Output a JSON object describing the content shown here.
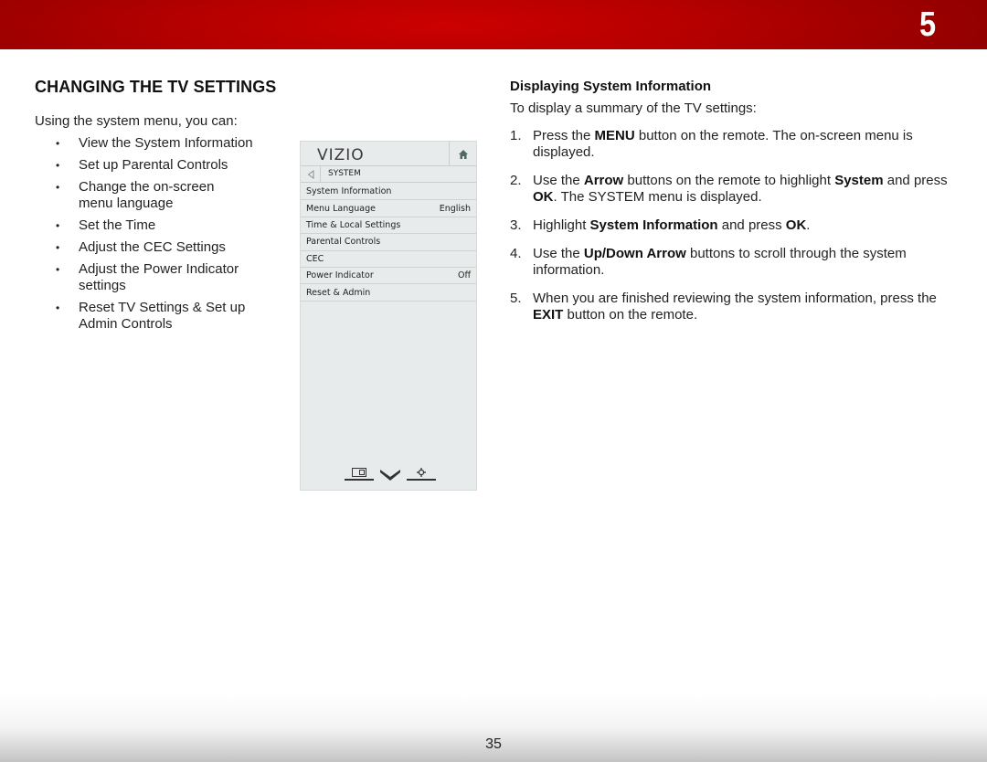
{
  "header": {
    "chapter_number": "5",
    "band_color": "#c00000"
  },
  "left": {
    "section_title": "CHANGING THE TV SETTINGS",
    "intro": "Using the system menu, you can:",
    "bullet_glyph": "•",
    "bullets": [
      "View the System Information",
      "Set up Parental Controls",
      "Change the on-screen menu language",
      "Set the Time",
      "Adjust the CEC Settings",
      "Adjust the Power Indicator settings",
      "Reset TV Settings & Set up Admin Controls"
    ]
  },
  "tv_menu": {
    "logo": "VIZIO",
    "home_icon": "home-icon",
    "back_icon": "back-arrow-icon",
    "breadcrumb": "SYSTEM",
    "items": [
      {
        "label": "System Information",
        "value": ""
      },
      {
        "label": "Menu Language",
        "value": "English"
      },
      {
        "label": "Time & Local Settings",
        "value": ""
      },
      {
        "label": "Parental Controls",
        "value": ""
      },
      {
        "label": "CEC",
        "value": ""
      },
      {
        "label": "Power Indicator",
        "value": "Off"
      },
      {
        "label": "Reset & Admin",
        "value": ""
      }
    ],
    "bottom_icons": [
      "wide-screen-icon",
      "vizio-v-icon",
      "settings-gear-icon"
    ]
  },
  "right": {
    "sub_title": "Displaying System Information",
    "intro": "To display a summary of the TV settings:",
    "steps": [
      {
        "num": "1.",
        "parts": [
          {
            "t": "Press the ",
            "b": false
          },
          {
            "t": "MENU",
            "b": true
          },
          {
            "t": " button on the remote. The on-screen menu is displayed.",
            "b": false
          }
        ]
      },
      {
        "num": "2.",
        "parts": [
          {
            "t": "Use the ",
            "b": false
          },
          {
            "t": "Arrow",
            "b": true
          },
          {
            "t": " buttons on the remote to highlight ",
            "b": false
          },
          {
            "t": "System",
            "b": true
          },
          {
            "t": " and press ",
            "b": false
          },
          {
            "t": "OK",
            "b": true
          },
          {
            "t": ". The SYSTEM menu is displayed.",
            "b": false
          }
        ]
      },
      {
        "num": "3.",
        "parts": [
          {
            "t": "Highlight ",
            "b": false
          },
          {
            "t": "System Information",
            "b": true
          },
          {
            "t": " and press ",
            "b": false
          },
          {
            "t": "OK",
            "b": true
          },
          {
            "t": ".",
            "b": false
          }
        ]
      },
      {
        "num": "4.",
        "parts": [
          {
            "t": "Use the ",
            "b": false
          },
          {
            "t": "Up/Down Arrow",
            "b": true
          },
          {
            "t": " buttons to scroll through the system information.",
            "b": false
          }
        ]
      },
      {
        "num": "5.",
        "parts": [
          {
            "t": "When you are finished reviewing the system information, press the ",
            "b": false
          },
          {
            "t": "EXIT",
            "b": true
          },
          {
            "t": " button on the remote.",
            "b": false
          }
        ]
      }
    ]
  },
  "footer": {
    "page_number": "35"
  }
}
